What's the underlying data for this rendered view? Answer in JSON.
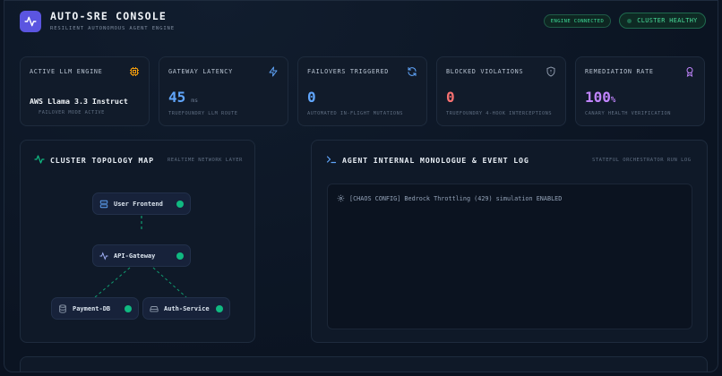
{
  "header": {
    "title": "AUTO-SRE CONSOLE",
    "subtitle": "RESILIENT AUTONOMOUS AGENT ENGINE",
    "engine_status": "ENGINE CONNECTED",
    "cluster_status": "CLUSTER HEALTHY"
  },
  "metrics": {
    "llm": {
      "label": "ACTIVE LLM ENGINE",
      "value": "AWS Llama 3.3 Instruct",
      "caption": "FAILOVER MODE ACTIVE",
      "icon": "cpu-icon"
    },
    "latency": {
      "label": "GATEWAY LATENCY",
      "value": "45",
      "unit": "ms",
      "caption": "TRUEFOUNDRY LLM ROUTE",
      "icon": "lightning-icon"
    },
    "failovers": {
      "label": "FAILOVERS TRIGGERED",
      "value": "0",
      "caption": "AUTOMATED IN-FLIGHT MUTATIONS",
      "icon": "refresh-icon"
    },
    "violations": {
      "label": "BLOCKED VIOLATIONS",
      "value": "0",
      "caption": "TRUEFOUNDRY 4-HOOK INTERCEPTIONS",
      "icon": "shield-icon"
    },
    "remediation": {
      "label": "REMEDIATION RATE",
      "value": "100",
      "unit": "%",
      "caption": "CANARY HEALTH VERIFICATION",
      "icon": "award-icon"
    }
  },
  "topology": {
    "title": "CLUSTER TOPOLOGY MAP",
    "tag": "REALTIME NETWORK LAYER",
    "nodes": {
      "frontend": "User Frontend",
      "gateway": "API-Gateway",
      "payment": "Payment-DB",
      "auth": "Auth-Service"
    }
  },
  "log": {
    "title": "AGENT INTERNAL MONOLOGUE & EVENT LOG",
    "tag": "STATEFUL ORCHESTRATOR RUN LOG",
    "entries": [
      "[CHAOS CONFIG] Bedrock Throttling (429) simulation ENABLED"
    ]
  },
  "colors": {
    "accent": "#5b55e0",
    "healthy": "#10b981",
    "latency": "#60a5fa",
    "failovers": "#60a5fa",
    "violations": "#f87171",
    "remediation": "#c084fc",
    "cpu_icon": "#f59e0b"
  }
}
